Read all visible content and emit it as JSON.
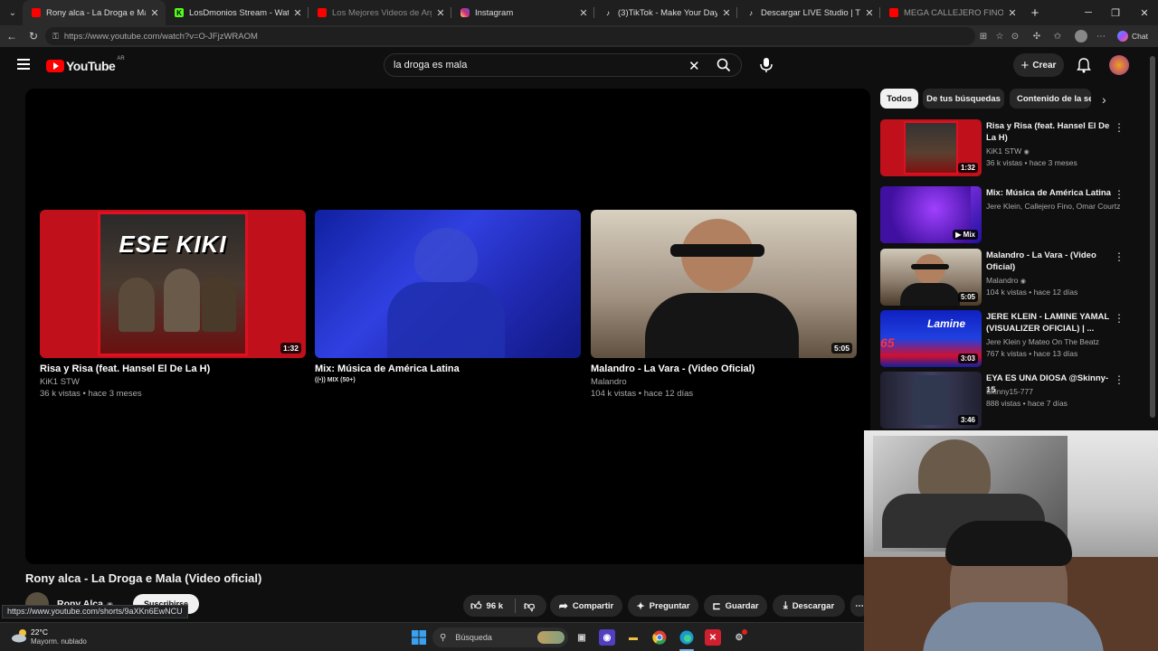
{
  "browser": {
    "tabs": [
      {
        "title": "Rony alca - La Droga e Mala (Vide",
        "active": true,
        "favicon": "youtube-icon",
        "color": "#ff0000"
      },
      {
        "title": "LosDmonios Stream - Watch Live o",
        "active": false,
        "favicon": "kick-icon",
        "color": "#53fc18"
      },
      {
        "title": "Los Mejores Videos de Argentina",
        "active": false,
        "favicon": "youtube-icon",
        "color": "#ff0000"
      },
      {
        "title": "Instagram",
        "active": false,
        "favicon": "instagram-icon",
        "color": "#d62976"
      },
      {
        "title": "(3)TikTok - Make Your Day",
        "active": false,
        "favicon": "tiktok-icon",
        "color": "#ffffff"
      },
      {
        "title": "Descargar LIVE Studio | TikTok",
        "active": false,
        "favicon": "tiktok-icon",
        "color": "#ffffff"
      },
      {
        "title": "MEGA CALLEJERO FINO RKT (VIDE",
        "active": false,
        "favicon": "youtube-icon",
        "color": "#ff0000"
      }
    ],
    "new_tab": "+",
    "url": "https://www.youtube.com/watch?v=O-JFjzWRAOM",
    "chat_label": "Chat",
    "status_url": "https://www.youtube.com/shorts/9aXKn6EwNCU"
  },
  "youtube": {
    "logo_text": "YouTube",
    "country_code": "AR",
    "search_value": "la droga es mala",
    "create_label": "Crear",
    "accent": "#ff0000"
  },
  "player": {
    "endscreen": [
      {
        "title": "Risa y Risa (feat. Hansel El De La H)",
        "channel": "KiK1 STW",
        "meta": "36 k vistas • hace 3 meses",
        "duration": "1:32",
        "thumb_text": "ESE KIKI"
      },
      {
        "title": "Mix: Música de América Latina",
        "channel": "MIX (50+)",
        "meta": "",
        "duration": "",
        "thumb_text": ""
      },
      {
        "title": "Malandro - La Vara - (Video Oficial)",
        "channel": "Malandro",
        "meta": "104 k vistas • hace 12 días",
        "duration": "5:05",
        "thumb_text": ""
      }
    ]
  },
  "video": {
    "title": "Rony alca - La Droga e Mala (Video oficial)",
    "channel": "Rony Alca",
    "subscribe": "Suscribirse",
    "likes": "96 k",
    "share": "Compartir",
    "ask": "Preguntar",
    "save": "Guardar",
    "download": "Descargar"
  },
  "sidebar": {
    "chips": [
      "Todos",
      "De tus búsquedas",
      "Contenido de la ser"
    ],
    "items": [
      {
        "title": "Risa y Risa (feat. Hansel El De La H)",
        "channel": "KiK1 STW",
        "meta": "36 k vistas • hace 3 meses",
        "duration": "1:32",
        "verified": true
      },
      {
        "title": "Mix: Música de América Latina",
        "channel": "Jere Klein, Callejero Fino, Omar Courtz y ...",
        "meta": "",
        "duration": "Mix",
        "verified": false
      },
      {
        "title": "Malandro - La Vara - (Video Oficial)",
        "channel": "Malandro",
        "meta": "104 k vistas • hace 12 días",
        "duration": "5:05",
        "verified": true
      },
      {
        "title": "JERE KLEIN - LAMINE YAMAL (VISUALIZER OFICIAL) | ...",
        "channel": "Jere Klein  y Mateo On The Beatz",
        "meta": "767 k vistas • hace 13 días",
        "duration": "3:03",
        "verified": true
      },
      {
        "title": "EYA ES UNA DIOSA @Skinny-15",
        "channel": "Skinny15-777",
        "meta": "888 vistas • hace 7 días",
        "duration": "3:46",
        "verified": false
      }
    ]
  },
  "taskbar": {
    "weather_temp": "22°C",
    "weather_desc": "Mayorm. nublado",
    "search_placeholder": "Búsqueda"
  }
}
